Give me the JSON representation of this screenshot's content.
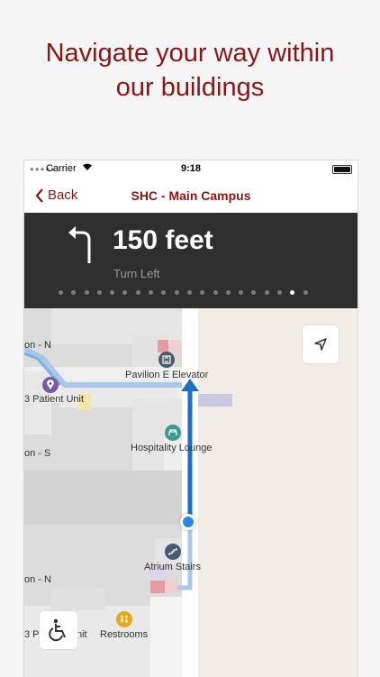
{
  "headline": {
    "line1": "Navigate your way within",
    "line2": "our buildings"
  },
  "status_bar": {
    "carrier": "Carrier",
    "time": "9:18"
  },
  "nav": {
    "back_label": "Back",
    "title": "SHC - Main Campus"
  },
  "direction": {
    "distance": "150 feet",
    "instruction": "Turn Left",
    "icon": "turn-left-arrow-icon",
    "step_count": 20,
    "active_step": 18
  },
  "map": {
    "labels": {
      "wing_n": "on - N",
      "patient_unit": "3 Patient Unit",
      "pavilion_elevator": "Pavilion E Elevator",
      "hospitality_lounge": "Hospitality Lounge",
      "wing_s": "on - S",
      "atrium_stairs": "Atrium Stairs",
      "wing_n2": "on - N",
      "patient_unit2": "3 Pa",
      "unit_suffix": "nit",
      "restrooms": "Restrooms"
    },
    "icons": {
      "elevator": "elevator-icon",
      "lounge": "lounge-icon",
      "stairs": "stairs-icon",
      "restrooms": "restrooms-icon",
      "patient_unit": "location-pin-icon"
    }
  },
  "colors": {
    "brand": "#8c1515",
    "route": "#1f6fc5",
    "banner": "#2f2f2f"
  }
}
